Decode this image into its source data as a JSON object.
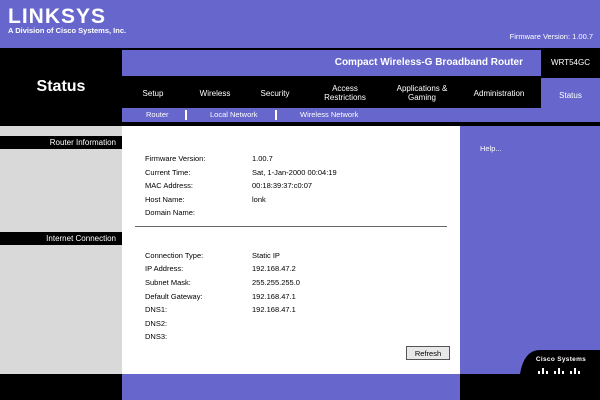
{
  "brand": {
    "logo": "LINKSYS",
    "subtitle": "A Division of Cisco Systems, Inc.",
    "firmware_top": "Firmware Version: 1.00.7",
    "cisco": "Cisco Systems"
  },
  "product": {
    "name": "Compact Wireless-G Broadband Router",
    "model": "WRT54GC"
  },
  "page": {
    "title": "Status"
  },
  "tabs": [
    {
      "label": "Setup"
    },
    {
      "label": "Wireless"
    },
    {
      "label": "Security"
    },
    {
      "label": "Access\nRestrictions"
    },
    {
      "label": "Applications &\nGaming"
    },
    {
      "label": "Administration"
    },
    {
      "label": "Status"
    }
  ],
  "subtabs": [
    "Router",
    "Local Network",
    "Wireless Network"
  ],
  "sections": {
    "router_info": "Router Information",
    "internet": "Internet Connection"
  },
  "router_info": {
    "firmware": {
      "label": "Firmware Version:",
      "value": "1.00.7"
    },
    "time": {
      "label": "Current Time:",
      "value": "Sat, 1-Jan-2000 00:04:19"
    },
    "mac": {
      "label": "MAC Address:",
      "value": "00:18:39:37:c0:07"
    },
    "host": {
      "label": "Host Name:",
      "value": "lonk"
    },
    "domain": {
      "label": "Domain Name:",
      "value": ""
    }
  },
  "internet": {
    "type": {
      "label": "Connection Type:",
      "value": "Static IP"
    },
    "ip": {
      "label": "IP Address:",
      "value": "192.168.47.2"
    },
    "mask": {
      "label": "Subnet Mask:",
      "value": "255.255.255.0"
    },
    "gateway": {
      "label": "Default Gateway:",
      "value": "192.168.47.1"
    },
    "dns1": {
      "label": "DNS1:",
      "value": "192.168.47.1"
    },
    "dns2": {
      "label": "DNS2:",
      "value": ""
    },
    "dns3": {
      "label": "DNS3:",
      "value": ""
    }
  },
  "buttons": {
    "refresh": "Refresh"
  },
  "help": {
    "label": "Help..."
  },
  "colors": {
    "accent": "#6666cc",
    "band": "#000000",
    "side": "#d9d9d9"
  }
}
